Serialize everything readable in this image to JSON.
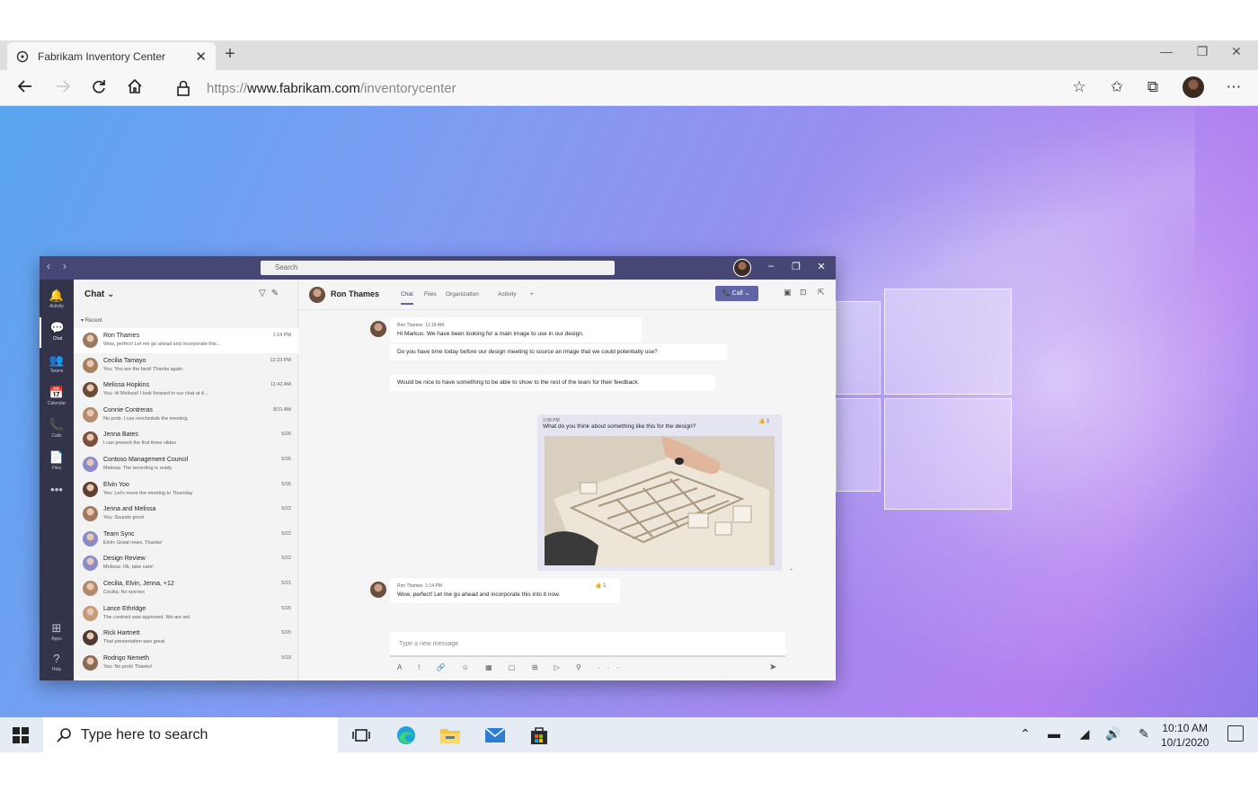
{
  "browser": {
    "tab_title": "Fabrikam Inventory Center",
    "tab_close": "✕",
    "new_tab": "+",
    "url_prefix": "https://",
    "url_host": "www.fabrikam.com",
    "url_path": "/inventorycenter",
    "win_minimize": "—",
    "win_restore": "❐",
    "win_close": "✕"
  },
  "taskbar": {
    "search_placeholder": "Type here to search",
    "time": "10:10 AM",
    "date": "10/1/2020"
  },
  "teams": {
    "search_placeholder": "Search",
    "chat_header": "Chat",
    "recent_label": "Recent",
    "rail": [
      {
        "icon": "bell-icon",
        "glyph": "🔔",
        "label": "Activity"
      },
      {
        "icon": "chat-icon",
        "glyph": "💬",
        "label": "Chat"
      },
      {
        "icon": "teams-icon",
        "glyph": "👥",
        "label": "Teams"
      },
      {
        "icon": "calendar-icon",
        "glyph": "📅",
        "label": "Calendar"
      },
      {
        "icon": "calls-icon",
        "glyph": "📞",
        "label": "Calls"
      },
      {
        "icon": "files-icon",
        "glyph": "📄",
        "label": "Files"
      },
      {
        "icon": "more-icon",
        "glyph": "•••",
        "label": ""
      },
      {
        "icon": "apps-icon",
        "glyph": "⊞",
        "label": "Apps"
      },
      {
        "icon": "help-icon",
        "glyph": "?",
        "label": "Help"
      }
    ],
    "chats": [
      {
        "name": "Ron Thames",
        "preview": "Wow, perfect! Let me go ahead and incorporate this...",
        "time": "1:14 PM",
        "color": "#9b7a64"
      },
      {
        "name": "Cecilia Tamayo",
        "preview": "You: You are the best! Thanks again.",
        "time": "12:23 PM",
        "color": "#a7805e"
      },
      {
        "name": "Melissa Hopkins",
        "preview": "You: Hi Melissa! I look forward to our chat at 4...",
        "time": "11:42 AM",
        "color": "#6b4a3a"
      },
      {
        "name": "Connie Contreras",
        "preview": "No prob. I can reschedule the meeting.",
        "time": "8/11 AM",
        "color": "#b58c70"
      },
      {
        "name": "Jenna Bates",
        "preview": "I can present the first three slides",
        "time": "5/26",
        "color": "#7a5040"
      },
      {
        "name": "Contoso Management Council",
        "preview": "Melissa: The recording is ready",
        "time": "5/26",
        "color": "#8b8cc7"
      },
      {
        "name": "Elvin Yoo",
        "preview": "You: Let's move the meeting to Thursday",
        "time": "5/26",
        "color": "#5e3e30"
      },
      {
        "name": "Jenna and Melissa",
        "preview": "You: Sounds good",
        "time": "5/22",
        "color": "#a07a60"
      },
      {
        "name": "Team Sync",
        "preview": "Elvin: Great news. Thanks!",
        "time": "5/22",
        "color": "#8b8cc7"
      },
      {
        "name": "Design Review",
        "preview": "Melissa: Ok, take care!",
        "time": "5/22",
        "color": "#8b8cc7"
      },
      {
        "name": "Cecilia, Elvin, Jenna, +12",
        "preview": "Cecilia: No worries",
        "time": "5/21",
        "color": "#b08a6e"
      },
      {
        "name": "Lance Ethridge",
        "preview": "The contract was approved. We are set.",
        "time": "5/20",
        "color": "#c49a7a"
      },
      {
        "name": "Rick Hartnett",
        "preview": "That presentation was great",
        "time": "5/20",
        "color": "#4d3a30"
      },
      {
        "name": "Rodrigo Nemeth",
        "preview": "You: No prob! Thanks!",
        "time": "5/19",
        "color": "#8a6a58"
      }
    ],
    "conversation": {
      "contact": "Ron Thames",
      "tabs": [
        "Chat",
        "Files",
        "Organization",
        "Activity",
        "+"
      ],
      "call_label": "Call",
      "messages": [
        {
          "sender": "Ron Thames",
          "time": "11:18 AM",
          "text": "Hi Markus. We have been looking for a main image to use in our design."
        },
        {
          "text": "Do you have time today before our design meeting to source an image that we could potentially use?"
        },
        {
          "text": "Would be nice to have something to be able to show to the rest of the team for their feedback."
        }
      ],
      "my_message": {
        "time": "1:08 PM",
        "text": "What do you think about something like this for the design?",
        "reaction": "👍 1"
      },
      "reply": {
        "sender": "Ron Thames",
        "time": "1:14 PM",
        "text": "Wow, perfect! Let me go ahead and incorporate this into it now.",
        "reaction": "👍 1"
      },
      "composer_placeholder": "Type a new message",
      "composer_tools": "A ! 🔗 ☺ ▦ ▢ ⊞ ▷ ⚲ ···",
      "send_glyph": "➤"
    }
  }
}
